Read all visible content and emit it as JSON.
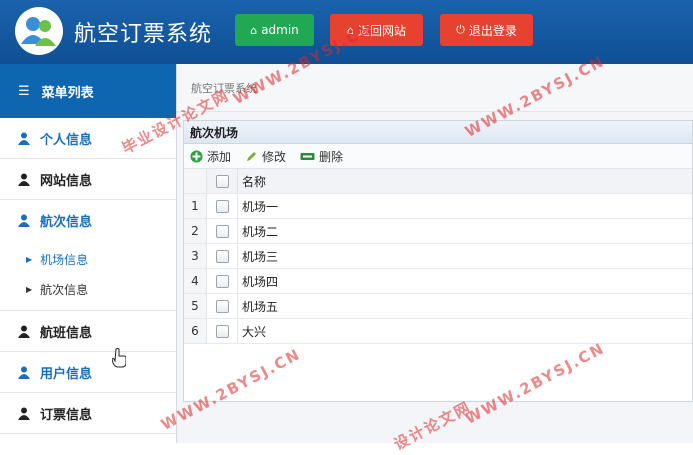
{
  "header": {
    "title": "航空订票系统",
    "admin_label": "admin",
    "back_label": "返回网站",
    "logout_label": "退出登录"
  },
  "sidebar": {
    "menu_title": "菜单列表",
    "items": [
      {
        "label": "个人信息"
      },
      {
        "label": "网站信息"
      },
      {
        "label": "航次信息"
      },
      {
        "label": "航班信息"
      },
      {
        "label": "用户信息"
      },
      {
        "label": "订票信息"
      }
    ],
    "sub_items": [
      {
        "label": "机场信息"
      },
      {
        "label": "航次信息"
      }
    ]
  },
  "main": {
    "breadcrumb": "航空订票系统",
    "panel_title": "航次机场",
    "toolbar": {
      "add_label": "添加",
      "edit_label": "修改",
      "delete_label": "删除"
    },
    "column_header": "名称",
    "rows": [
      {
        "num": "1",
        "name": "机场一"
      },
      {
        "num": "2",
        "name": "机场二"
      },
      {
        "num": "3",
        "name": "机场三"
      },
      {
        "num": "4",
        "name": "机场四"
      },
      {
        "num": "5",
        "name": "机场五"
      },
      {
        "num": "6",
        "name": "大兴"
      }
    ]
  },
  "watermarks": {
    "w1": "毕业设计论文网",
    "w2": "WWW.2BYSJ.CN",
    "w3": "WWW.2BYSJ.CN",
    "w4": "WWW.2BYSJ.CN",
    "w5": "WWW.2BYSJ.CN",
    "w6": "设计论文网"
  },
  "colors": {
    "header_blue": "#0f4f95",
    "menu_blue": "#0e65b0",
    "green_button": "#22a853",
    "red_button": "#e7412f"
  }
}
